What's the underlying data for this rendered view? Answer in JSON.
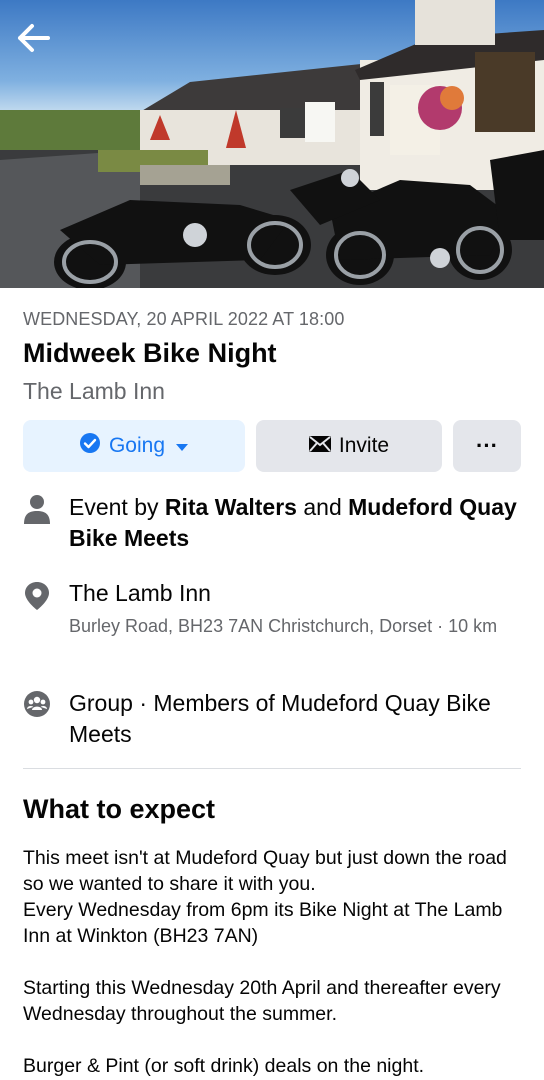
{
  "header": {
    "back_icon": "arrow-left-icon"
  },
  "event": {
    "datetime": "WEDNESDAY, 20 APRIL 2022 AT 18:00",
    "title": "Midweek Bike Night",
    "venue": "The Lamb Inn"
  },
  "actions": {
    "going_label": "Going",
    "invite_label": "Invite",
    "more_label": "···"
  },
  "details": {
    "host_prefix": "Event by ",
    "host_1": "Rita Walters",
    "host_joiner": " and ",
    "host_2": "Mudeford Quay Bike Meets",
    "location_name": "The Lamb Inn",
    "location_address": "Burley Road, BH23 7AN Christchurch, Dorset · 10 km",
    "group_text": "Group · Members of Mudeford Quay Bike Meets"
  },
  "about": {
    "heading": "What to expect",
    "lines": [
      "This meet isn't at Mudeford Quay but just down the road so we wanted to share it with you.",
      "Every Wednesday from 6pm its Bike Night at The Lamb Inn at Winkton (BH23 7AN)",
      "",
      "Starting this Wednesday 20th April and thereafter every Wednesday throughout the summer.",
      "",
      "Burger & Pint (or soft drink) deals on the night."
    ]
  },
  "colors": {
    "accent": "#1877f2",
    "going_bg": "#e7f3ff",
    "secondary_bg": "#e4e6eb",
    "muted_text": "#65676b"
  }
}
